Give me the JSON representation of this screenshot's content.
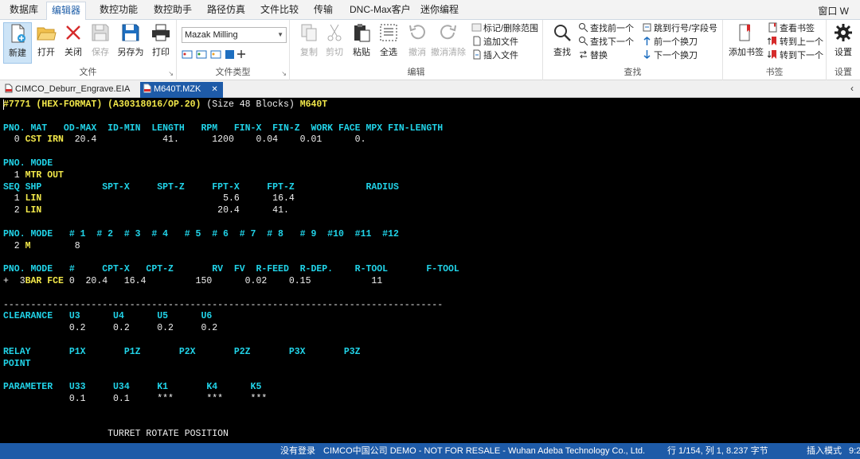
{
  "menu": {
    "tabs": [
      "数据库",
      "编辑器",
      "数控功能",
      "数控助手",
      "路径仿真",
      "文件比较",
      "传输",
      "DNC-Max客户",
      "迷你编程"
    ],
    "active_tab": "编辑器",
    "window_label": "窗口 W"
  },
  "ribbon": {
    "file_group": {
      "label": "文件",
      "new": "新建",
      "open": "打开",
      "close": "关闭",
      "save": "保存",
      "save_as": "另存为",
      "print": "打印"
    },
    "filetype_group": {
      "label": "文件类型",
      "machine": "Mazak Milling"
    },
    "edit_group": {
      "label": "编辑",
      "copy": "复制",
      "cut": "剪切",
      "paste": "粘贴",
      "select_all": "全选",
      "undo": "撤消",
      "undo_clear": "撤消清除",
      "mark_delete_range": "标记/删除范围",
      "append_file": "追加文件",
      "insert_file": "插入文件"
    },
    "find_group": {
      "label": "查找",
      "find": "查找",
      "find_prev": "查找前一个",
      "find_next": "查找下一个",
      "replace": "替换",
      "goto_line": "跳到行号/字段号",
      "prev_tool": "前一个换刀",
      "next_tool": "下一个换刀"
    },
    "bookmark_group": {
      "label": "书签",
      "add_bookmark": "添加书签",
      "view_bookmark": "查看书签",
      "goto_prev": "转到上一个",
      "goto_next": "转到下一个"
    },
    "settings_group": {
      "label": "设置",
      "settings": "设置"
    }
  },
  "file_tabs": [
    {
      "name": "CIMCO_Deburr_Engrave.EIA",
      "active": false
    },
    {
      "name": "M640T.MZK",
      "active": true
    }
  ],
  "editor_lines": [
    [
      [
        "#7771 ",
        "y"
      ],
      [
        "(HEX-FORMAT) (A30318016/OP.20) ",
        "y"
      ],
      [
        "(Size 48 Blocks) ",
        "w"
      ],
      [
        "M640T",
        "y"
      ]
    ],
    [],
    [
      [
        "PNO. MAT   OD-MAX  ID-MIN  LENGTH   RPM   FIN-X  FIN-Z  WORK FACE MPX FIN-LENGTH",
        "c"
      ]
    ],
    [
      [
        "  0 ",
        "w"
      ],
      [
        "CST IRN",
        "y"
      ],
      [
        "  20.4            41.      1200    0.04    0.01      0.",
        "w"
      ]
    ],
    [],
    [
      [
        "PNO. MODE",
        "c"
      ]
    ],
    [
      [
        "  1 ",
        "w"
      ],
      [
        "MTR OUT",
        "y"
      ]
    ],
    [
      [
        "SEQ SHP           SPT-X     SPT-Z     FPT-X     FPT-Z             RADIUS",
        "c"
      ]
    ],
    [
      [
        "  1 ",
        "w"
      ],
      [
        "LIN",
        "y"
      ],
      [
        "                                 5.6      16.4",
        "w"
      ]
    ],
    [
      [
        "  2 ",
        "w"
      ],
      [
        "LIN",
        "y"
      ],
      [
        "                                20.4      41.",
        "w"
      ]
    ],
    [],
    [
      [
        "PNO. MODE   # 1  # 2  # 3  # 4   # 5  # 6  # 7  # 8   # 9  #10  #11  #12",
        "c"
      ]
    ],
    [
      [
        "  2 ",
        "w"
      ],
      [
        "M",
        "y"
      ],
      [
        "        8",
        "w"
      ]
    ],
    [],
    [
      [
        "PNO. MODE   #     CPT-X   CPT-Z       RV  FV  R-FEED  R-DEP.    R-TOOL       F-TOOL",
        "c"
      ]
    ],
    [
      [
        "+  3",
        "w"
      ],
      [
        "BAR FCE",
        "y"
      ],
      [
        " 0  20.4   16.4         150      0.02    0.15           11",
        "w"
      ]
    ],
    [],
    [
      [
        "--------------------------------------------------------------------------------",
        "w"
      ]
    ],
    [
      [
        "CLEARANCE   ",
        "c"
      ],
      [
        "U3      U4      U5      U6",
        "c"
      ]
    ],
    [
      [
        "            0.2     0.2     0.2     0.2",
        "w"
      ]
    ],
    [],
    [
      [
        "RELAY       P1X       P1Z       P2X       P2Z       P3X       P3Z",
        "c"
      ]
    ],
    [
      [
        "POINT",
        "c"
      ]
    ],
    [],
    [
      [
        "PARAMETER   U33     U34     K1       K4      K5",
        "c"
      ]
    ],
    [
      [
        "            0.1     0.1     ***      ***     ***",
        "w"
      ]
    ],
    [],
    [],
    [
      [
        "                   TURRET ROTATE POSITION",
        "w"
      ]
    ]
  ],
  "status": {
    "login": "没有登录",
    "company": "CIMCO中国公司 DEMO - NOT FOR RESALE - Wuhan Adeba Technology Co., Ltd.",
    "position": "行 1/154, 列 1, 8.237 字节",
    "mode": "插入模式",
    "time": "9:2"
  }
}
